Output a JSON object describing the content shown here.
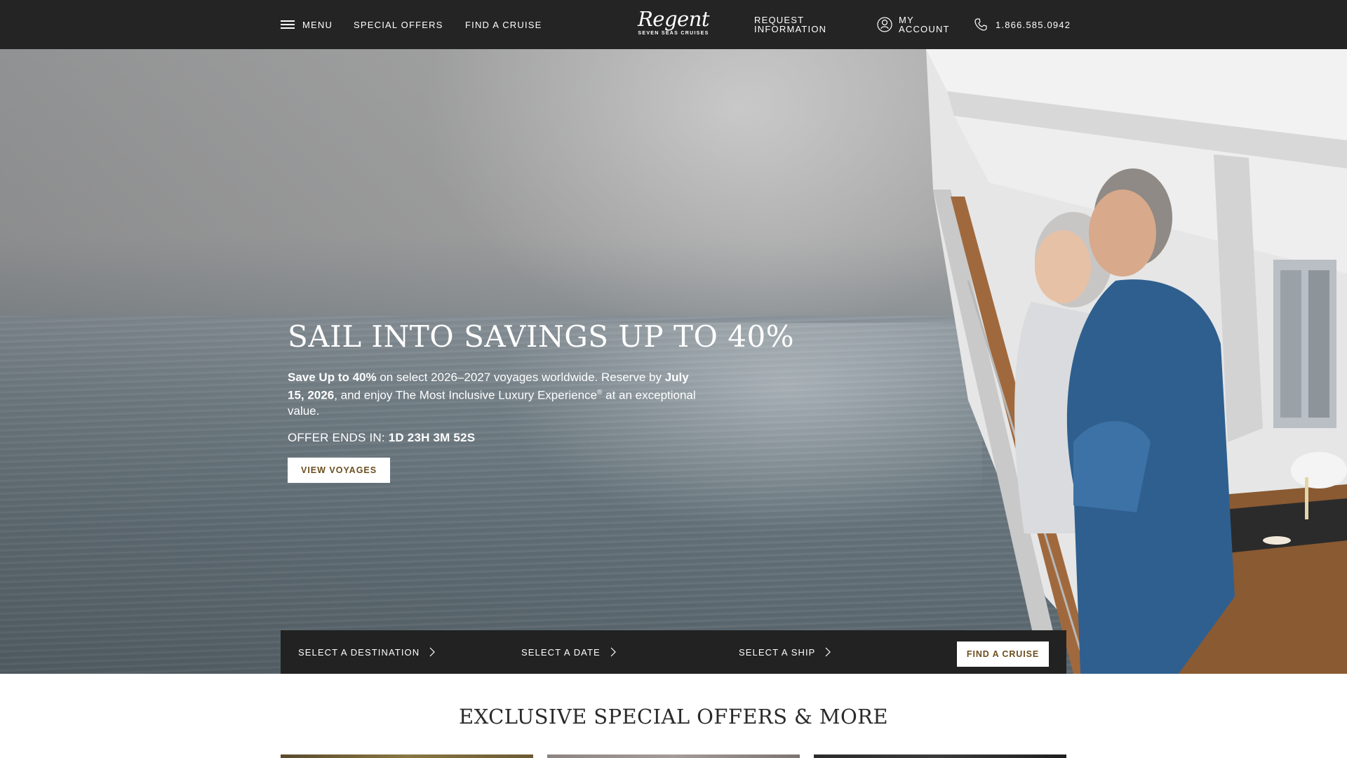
{
  "header": {
    "menu_label": "MENU",
    "special_offers_label": "SPECIAL OFFERS",
    "find_cruise_label": "FIND A CRUISE",
    "logo": {
      "script": "Regent",
      "sub": "SEVEN SEAS CRUISES"
    },
    "request_info_line1": "REQUEST",
    "request_info_line2": "INFORMATION",
    "account_line1": "MY",
    "account_line2": "ACCOUNT",
    "phone": "1.866.585.0942",
    "icons": [
      "hamburger-icon",
      "account-icon",
      "phone-icon"
    ]
  },
  "hero": {
    "title": "SAIL INTO SAVINGS UP TO 40%",
    "desc_bold_1": "Save Up to 40%",
    "desc_text_1": " on select 2026–2027 voyages worldwide. Reserve by ",
    "desc_bold_2": "July 15, 2026",
    "desc_text_2": ", and enjoy The Most Inclusive Luxury Experience",
    "desc_reg": "®",
    "desc_text_3": " at an exceptional value.",
    "countdown_label": "OFFER ENDS IN: ",
    "countdown_value": "1D 23H 3M 52S",
    "cta_label": "VIEW VOYAGES"
  },
  "search_bar": {
    "destination_label": "SELECT A DESTINATION",
    "date_label": "SELECT A DATE",
    "ship_label": "SELECT A SHIP",
    "submit_label": "FIND A CRUISE"
  },
  "offers": {
    "title": "EXCLUSIVE SPECIAL OFFERS & MORE"
  },
  "colors": {
    "header_bg": "#242424",
    "button_text": "#6b4e1e",
    "search_bar_bg": "#222222"
  }
}
